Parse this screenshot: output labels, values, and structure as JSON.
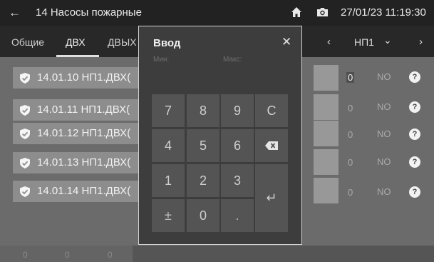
{
  "topbar": {
    "back_icon": "arrow-left-icon",
    "title": "14 Насосы пожарные",
    "home_icon": "home-icon",
    "camera_icon": "camera-icon",
    "datetime": "27/01/23 11:19:30"
  },
  "tabs": [
    {
      "label": "Общие"
    },
    {
      "label": "ДВХ"
    },
    {
      "label": "ДВЫХ"
    }
  ],
  "nav": {
    "prev": "‹",
    "name": "НП1",
    "dropdown": "⌄",
    "next": "›"
  },
  "rows": [
    {
      "label": "14.01.10 НП1.ДВХ(",
      "value": "0",
      "state": "NO"
    },
    {
      "label": "14.01.11 НП1.ДВХ(",
      "value": "0",
      "state": "NO"
    },
    {
      "label": "14.01.12 НП1.ДВХ(",
      "value": "0",
      "state": "NO"
    },
    {
      "label": "14.01.13 НП1.ДВХ(",
      "value": "0",
      "state": "NO"
    },
    {
      "label": "14.01.14 НП1.ДВХ(",
      "value": "0",
      "state": "NO"
    }
  ],
  "help_glyph": "?",
  "bottom_values": [
    "0",
    "0",
    "0"
  ],
  "dialog": {
    "title": "Ввод",
    "close": "✕",
    "min_label": "Мин:",
    "max_label": "Макс:",
    "keys": {
      "k7": "7",
      "k8": "8",
      "k9": "9",
      "clear": "C",
      "k4": "4",
      "k5": "5",
      "k6": "6",
      "k1": "1",
      "k2": "2",
      "k3": "3",
      "sign": "±",
      "k0": "0",
      "dot": ".",
      "enter": "↵"
    },
    "backspace_icon": "backspace-icon"
  },
  "colors": {
    "topbar": "#222222",
    "background": "#6b6b6b",
    "dialog": "#3d3d3d",
    "key": "#545454",
    "row": "#8d8d8d"
  }
}
